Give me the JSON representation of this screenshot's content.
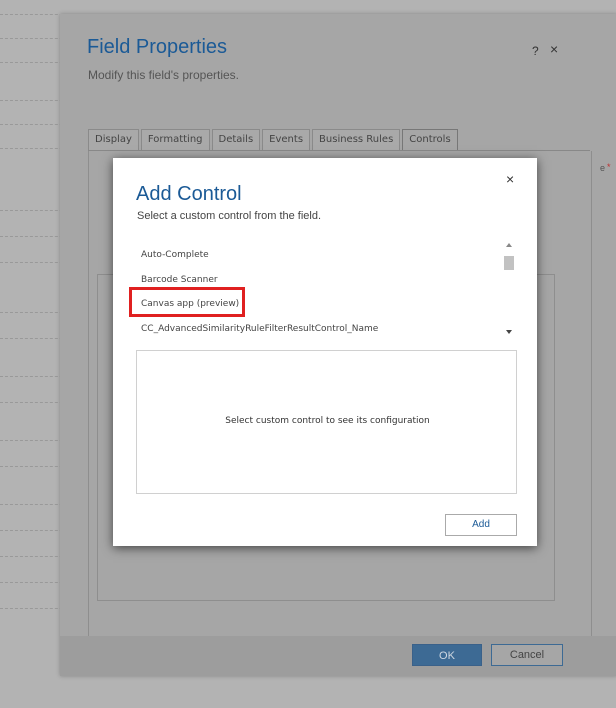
{
  "field_properties": {
    "title": "Field Properties",
    "subtitle": "Modify this field's properties.",
    "help_glyph": "?",
    "close_glyph": "×",
    "tabs": [
      {
        "label": "Display"
      },
      {
        "label": "Formatting"
      },
      {
        "label": "Details"
      },
      {
        "label": "Events"
      },
      {
        "label": "Business Rules"
      },
      {
        "label": "Controls",
        "active": true
      }
    ],
    "ok_label": "OK",
    "cancel_label": "Cancel",
    "right_edge_text": "e",
    "required_mark": "*"
  },
  "add_control": {
    "title": "Add Control",
    "subtitle": "Select a custom control from the field.",
    "close_glyph": "×",
    "controls": [
      "Auto-Complete",
      "Barcode Scanner",
      "Canvas app (preview)",
      "CC_AdvancedSimilarityRuleFilterResultControl_Name"
    ],
    "highlighted_item": "Canvas app (preview)",
    "config_placeholder": "Select custom control to see its configuration",
    "add_label": "Add"
  },
  "colors": {
    "overlay": "#b3b3b3",
    "title_blue": "#1b5a96",
    "highlight_red": "#e02020",
    "ok_button": "#3d6a94"
  }
}
